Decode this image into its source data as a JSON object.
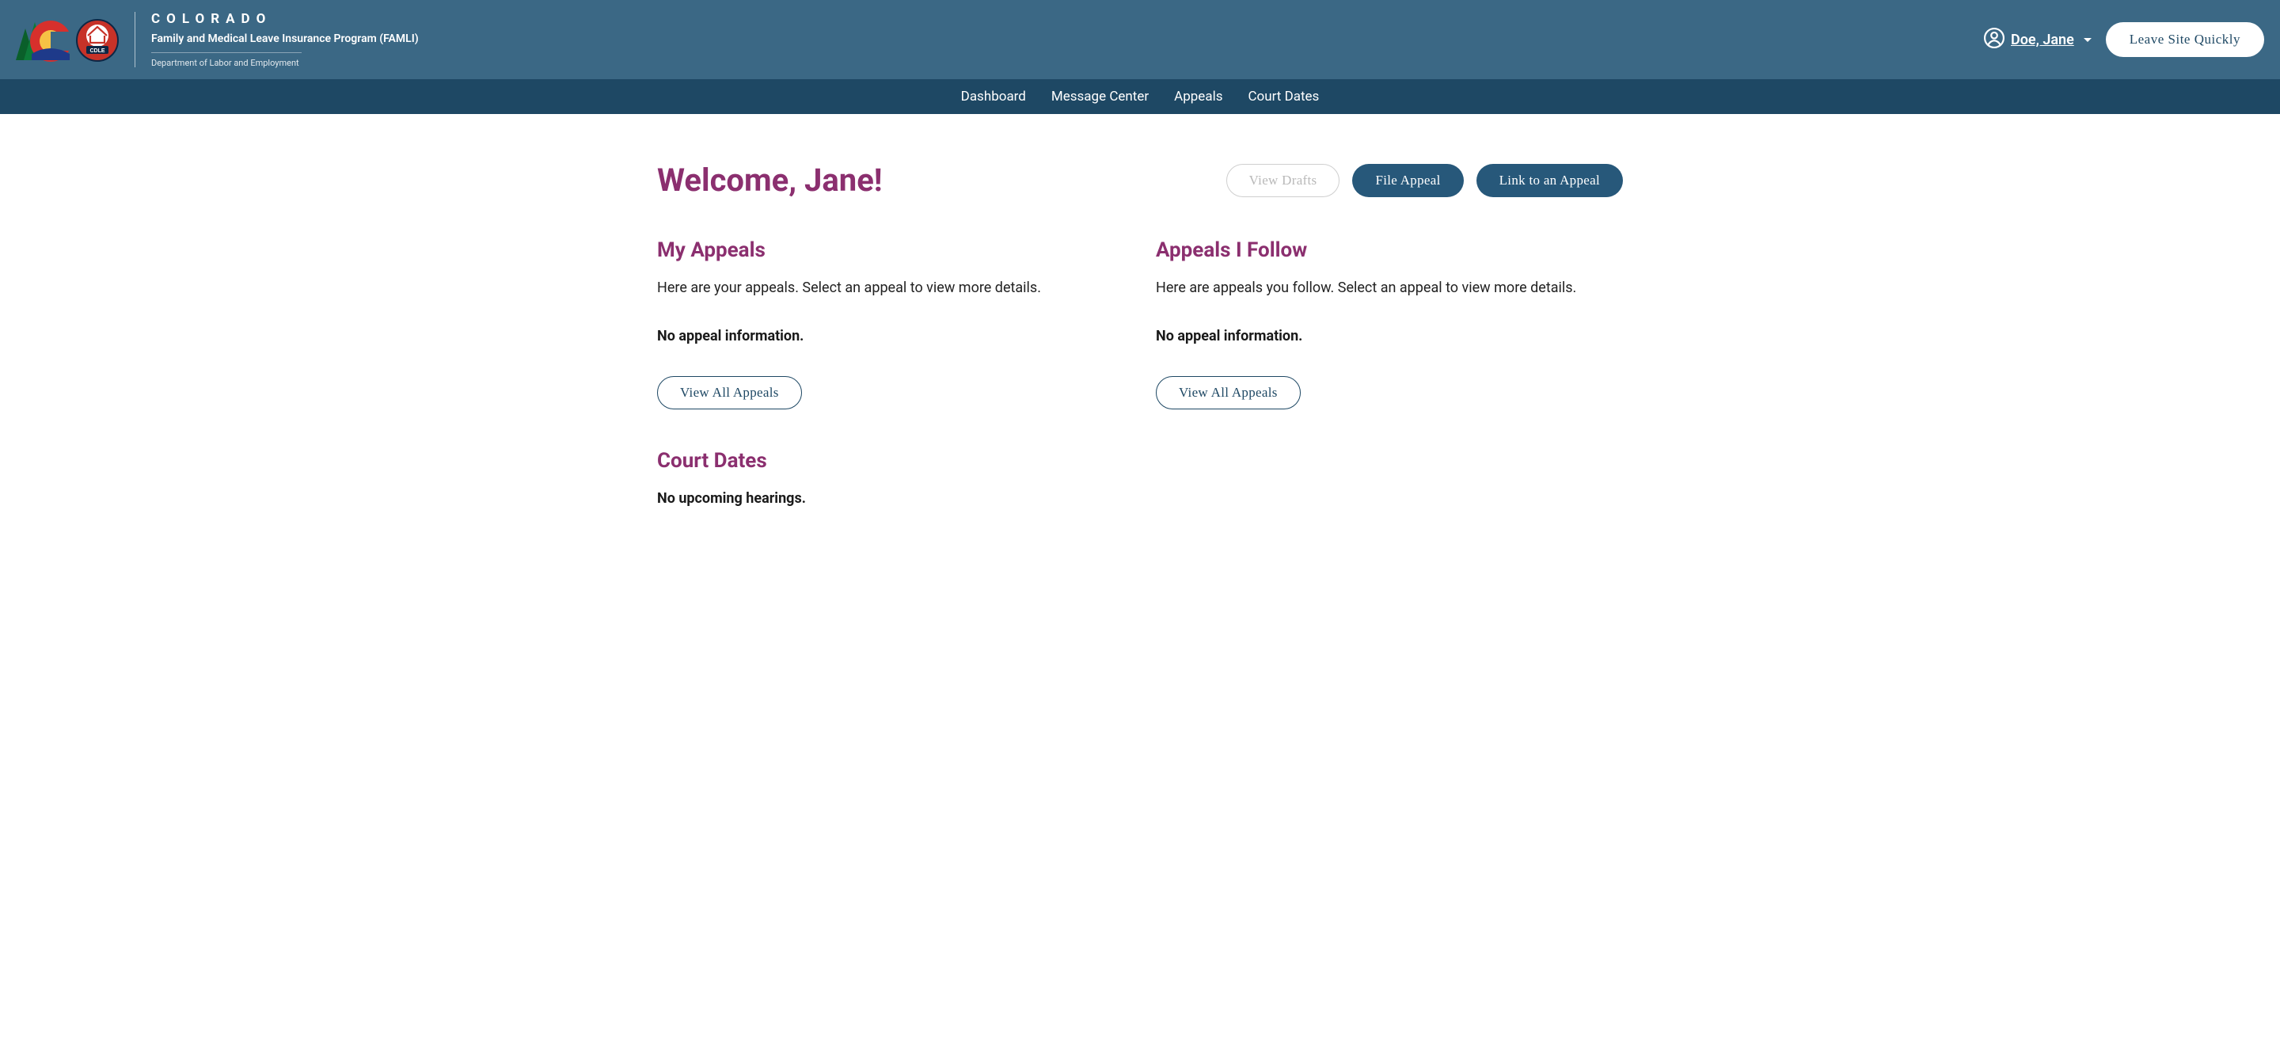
{
  "brand": {
    "title": "COLORADO",
    "subtitle": "Family and Medical Leave Insurance Program (FAMLI)",
    "department": "Department of Labor and Employment"
  },
  "header": {
    "user_name": "Doe, Jane",
    "leave_button": "Leave Site Quickly"
  },
  "nav": {
    "items": [
      {
        "label": "Dashboard"
      },
      {
        "label": "Message Center"
      },
      {
        "label": "Appeals"
      },
      {
        "label": "Court Dates"
      }
    ]
  },
  "main": {
    "welcome": "Welcome, Jane!",
    "actions": {
      "view_drafts": "View Drafts",
      "file_appeal": "File Appeal",
      "link_appeal": "Link to an Appeal"
    },
    "my_appeals": {
      "heading": "My Appeals",
      "desc": "Here are your appeals. Select an appeal to view more details.",
      "empty": "No appeal information.",
      "view_all": "View All Appeals"
    },
    "followed_appeals": {
      "heading": "Appeals I Follow",
      "desc": "Here are appeals you follow. Select an appeal to view more details.",
      "empty": "No appeal information.",
      "view_all": "View All Appeals"
    },
    "court_dates": {
      "heading": "Court Dates",
      "empty": "No upcoming hearings."
    }
  }
}
